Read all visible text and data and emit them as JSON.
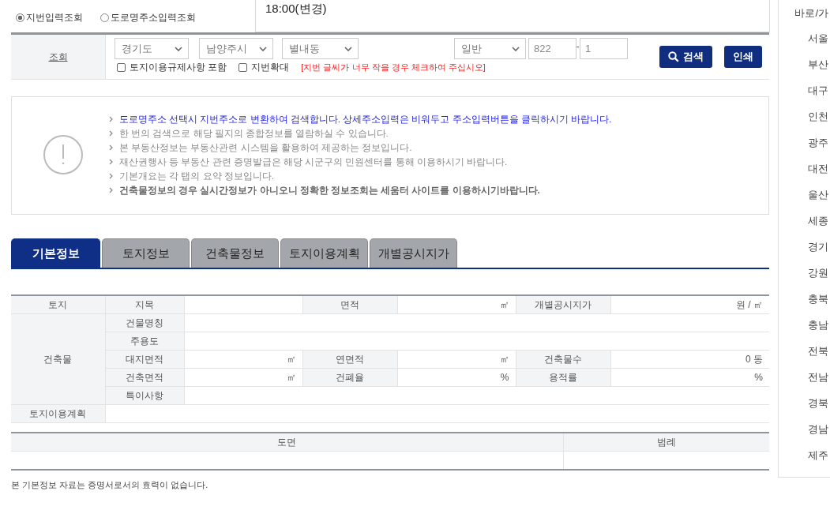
{
  "notice": {
    "text": "18:00(변경)"
  },
  "mode_radios": [
    {
      "label": "지번입력조회",
      "selected": true
    },
    {
      "label": "도로명주소입력조회",
      "selected": false
    }
  ],
  "search": {
    "label": "조회",
    "selects": [
      {
        "value": "경기도"
      },
      {
        "value": "남양주시"
      },
      {
        "value": "별내동"
      }
    ],
    "lot_type": {
      "value": "일반"
    },
    "main_number": "822",
    "separator": "-",
    "sub_number": "1",
    "checkboxes": [
      {
        "label": "토지이용규제사항 포함",
        "checked": false
      },
      {
        "label": "지번확대",
        "checked": false,
        "note": "[지번 글씨가 너무 작을 경우 체크하여 주십시오]"
      }
    ],
    "buttons": [
      {
        "label": "검색",
        "kind": "search"
      },
      {
        "label": "인쇄",
        "kind": "print"
      }
    ]
  },
  "info": {
    "lines": [
      {
        "text": "도로명주소 선택시 지번주소로 변환하여 검색합니다. 상세주소입력은 비워두고 주소입력버튼을 클릭하시기 바랍니다.",
        "kind": "link"
      },
      {
        "text": "한 번의 검색으로 해당 필지의 종합정보를 열람하실 수 있습니다.",
        "kind": "plain"
      },
      {
        "text": "본 부동산정보는 부동산관련 시스템을 활용하여 제공하는 정보입니다.",
        "kind": "plain"
      },
      {
        "text": "재산권행사 등 부동산 관련 증명발급은 해당 시군구의 민원센터를 통해 이용하시기 바랍니다.",
        "kind": "plain"
      },
      {
        "text": "기본개요는 각 탭의 요약 정보입니다.",
        "kind": "plain"
      },
      {
        "text": "건축물정보의 경우 실시간정보가 아니오니 정확한 정보조회는 세움터 사이트를 이용하시기바랍니다.",
        "kind": "bold"
      }
    ]
  },
  "tabs": [
    {
      "label": "기본정보",
      "selected": true
    },
    {
      "label": "토지정보",
      "selected": false
    },
    {
      "label": "건축물정보",
      "selected": false
    },
    {
      "label": "토지이용계획",
      "selected": false
    },
    {
      "label": "개별공시지가",
      "selected": false
    }
  ],
  "basic_table": {
    "rows": [
      [
        {
          "kind": "head",
          "text": "토지"
        },
        {
          "kind": "head",
          "text": "지목"
        },
        {
          "kind": "value"
        },
        {
          "kind": "head",
          "text": "면적"
        },
        {
          "kind": "value",
          "text": "㎡"
        },
        {
          "kind": "head",
          "text": "개별공시지가"
        },
        {
          "kind": "value",
          "text": "원 / ㎡"
        }
      ],
      [
        {
          "kind": "head",
          "text": "건축물",
          "rowspan": 5
        },
        {
          "kind": "head",
          "text": "건물명칭"
        },
        {
          "kind": "value",
          "colspan": 5
        }
      ],
      [
        {
          "kind": "head",
          "text": "주용도"
        },
        {
          "kind": "value",
          "colspan": 5
        }
      ],
      [
        {
          "kind": "head",
          "text": "대지면적"
        },
        {
          "kind": "value",
          "text": "㎡"
        },
        {
          "kind": "head",
          "text": "연면적"
        },
        {
          "kind": "value",
          "text": "㎡"
        },
        {
          "kind": "head",
          "text": "건축물수"
        },
        {
          "kind": "value",
          "text": "0 동"
        }
      ],
      [
        {
          "kind": "head",
          "text": "건축면적"
        },
        {
          "kind": "value",
          "text": "㎡"
        },
        {
          "kind": "head",
          "text": "건폐율"
        },
        {
          "kind": "value",
          "text": "%"
        },
        {
          "kind": "head",
          "text": "용적률"
        },
        {
          "kind": "value",
          "text": "%"
        }
      ],
      [
        {
          "kind": "head",
          "text": "특이사항"
        },
        {
          "kind": "value",
          "colspan": 5
        }
      ],
      [
        {
          "kind": "head",
          "text": "토지이용계획"
        },
        {
          "kind": "value",
          "colspan": 6
        }
      ]
    ]
  },
  "drawing_table": {
    "columns": [
      "도면",
      "범례"
    ]
  },
  "footer_note": "본 기본정보 자료는 증명서로서의 효력이 없습니다.",
  "sidebar": {
    "header": "바로/가",
    "items": [
      "서울",
      "부산",
      "대구",
      "인천",
      "광주",
      "대전",
      "울산",
      "세종",
      "경기",
      "강원",
      "충북",
      "충남",
      "전북",
      "전남",
      "경북",
      "경남",
      "제주"
    ]
  }
}
